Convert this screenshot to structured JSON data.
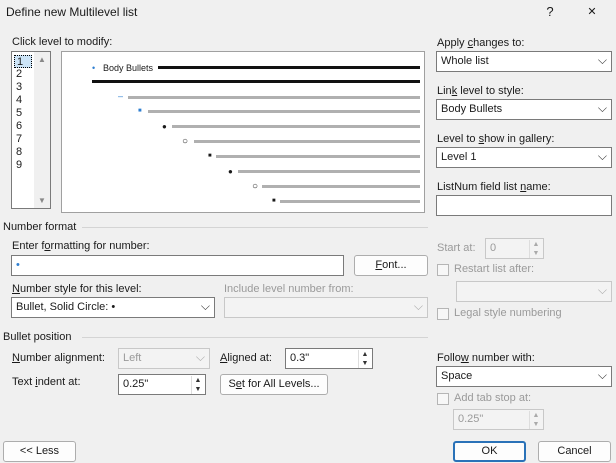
{
  "window": {
    "title": "Define new Multilevel list",
    "help_glyph": "?",
    "close_glyph": "✕"
  },
  "levels": {
    "label": "Click level to modify:",
    "items": [
      "1",
      "2",
      "3",
      "4",
      "5",
      "6",
      "7",
      "8",
      "9"
    ],
    "selected": "1"
  },
  "preview": {
    "level1_text": "Body Bullets",
    "markers": [
      "•",
      "–",
      "■",
      "●",
      "○",
      "■",
      "●",
      "○",
      "■"
    ]
  },
  "apply": {
    "label": "Apply changes to:",
    "value": "Whole list"
  },
  "link": {
    "label": "Link level to style:",
    "value": "Body Bullets"
  },
  "gallery": {
    "label": "Level to show in gallery:",
    "value": "Level 1"
  },
  "listnum": {
    "label": "ListNum field list name:",
    "value": ""
  },
  "number_format": {
    "section": "Number format",
    "enter_label": "Enter formatting for number:",
    "format_value": "•",
    "font_button": "Font...",
    "style_label": "Number style for this level:",
    "style_value": "Bullet, Solid Circle: •",
    "include_label": "Include level number from:",
    "include_value": "",
    "start_at_label": "Start at:",
    "start_at_value": "0",
    "restart_label": "Restart list after:",
    "restart_value": "",
    "legal_label": "Legal style numbering"
  },
  "bullet_position": {
    "section": "Bullet position",
    "alignment_label": "Number alignment:",
    "alignment_value": "Left",
    "aligned_at_label": "Aligned at:",
    "aligned_at_value": "0.3\"",
    "indent_label": "Text indent at:",
    "indent_value": "0.25\"",
    "set_all_button": "Set for All Levels...",
    "follow_label": "Follow number with:",
    "follow_value": "Space",
    "tab_stop_label": "Add tab stop at:",
    "tab_stop_value": "0.25\""
  },
  "buttons": {
    "less": "<< Less",
    "ok": "OK",
    "cancel": "Cancel"
  }
}
